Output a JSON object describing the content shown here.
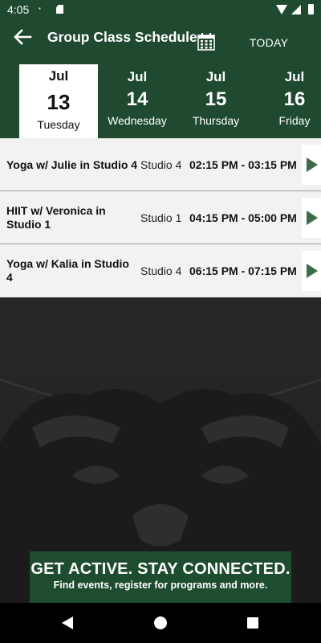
{
  "status_bar": {
    "time": "4:05",
    "icons": [
      "notification-icon",
      "sd-card-icon",
      "wifi-icon",
      "signal-icon",
      "battery-icon"
    ]
  },
  "app_bar": {
    "title": "Group Class Schedule",
    "back_icon": "arrow-left-icon",
    "calendar_icon": "calendar-icon",
    "today_label": "TODAY"
  },
  "days": [
    {
      "month": "",
      "day": "",
      "weekday": "y"
    },
    {
      "month": "Jul",
      "day": "13",
      "weekday": "Tuesday",
      "selected": true
    },
    {
      "month": "Jul",
      "day": "14",
      "weekday": "Wednesday"
    },
    {
      "month": "Jul",
      "day": "15",
      "weekday": "Thursday"
    },
    {
      "month": "Jul",
      "day": "16",
      "weekday": "Friday"
    }
  ],
  "classes": [
    {
      "name": "Yoga w/ Julie in Studio 4",
      "studio": "Studio 4",
      "time": "02:15 PM - 03:15 PM"
    },
    {
      "name": "HIIT w/ Veronica in Studio 1",
      "studio": "Studio 1",
      "time": "04:15 PM - 05:00 PM"
    },
    {
      "name": "Yoga w/ Kalia in Studio 4",
      "studio": "Studio 4",
      "time": "06:15 PM - 07:15 PM"
    }
  ],
  "banner": {
    "headline": "GET ACTIVE.  STAY CONNECTED.",
    "subline": "Find events, register for programs and more."
  },
  "colors": {
    "brand_green": "#1f4a30",
    "play_green": "#3d6b49",
    "row_bg": "#f2f2f2"
  }
}
